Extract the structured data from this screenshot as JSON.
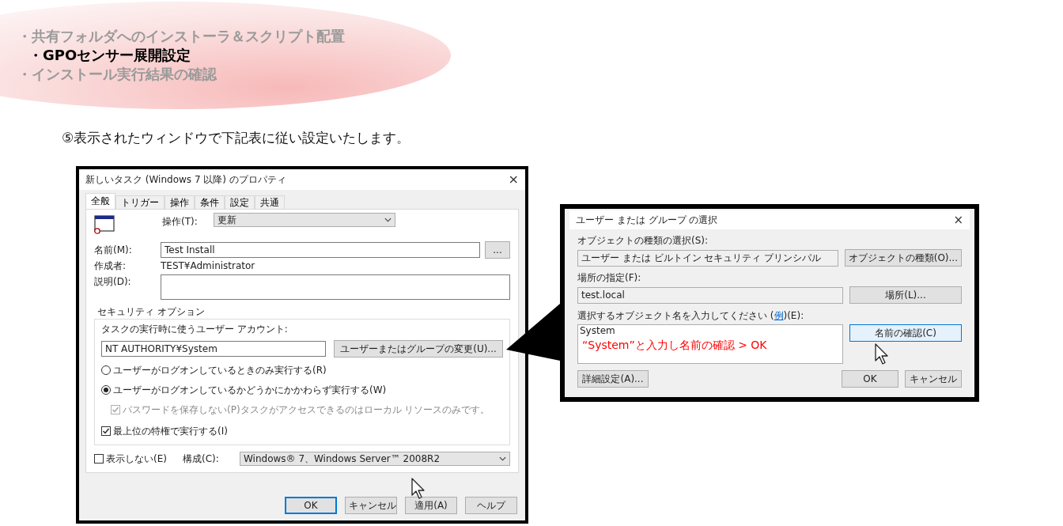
{
  "agenda": [
    {
      "text": "・共有フォルダへのインストーラ＆スクリプト配置",
      "selected": false
    },
    {
      "text": "・GPOセンサー展開設定",
      "selected": true
    },
    {
      "text": "・インストール実行結果の確認",
      "selected": false
    }
  ],
  "instruction": "⑤表示されたウィンドウで下記表に従い設定いたします。",
  "task_dialog": {
    "title": "新しいタスク (Windows 7 以降) のプロパティ",
    "close": "×",
    "tabs": [
      {
        "label": "全般",
        "selected": true
      },
      {
        "label": "トリガー",
        "selected": false
      },
      {
        "label": "操作",
        "selected": false
      },
      {
        "label": "条件",
        "selected": false
      },
      {
        "label": "設定",
        "selected": false
      },
      {
        "label": "共通",
        "selected": false
      }
    ],
    "action_label": "操作(T):",
    "action_value": "更新",
    "name_label": "名前(M):",
    "name_value": "Test Install",
    "browse_button": "...",
    "author_label": "作成者:",
    "author_value": "TEST¥Administrator",
    "description_label": "説明(D):",
    "security_group": "セキュリティ オプション",
    "account_label": "タスクの実行時に使うユーザー アカウント:",
    "account_value": "NT AUTHORITY¥System",
    "change_user_button": "ユーザーまたはグループの変更(U)...",
    "run_options": [
      {
        "label": "ユーザーがログオンしているときのみ実行する(R)",
        "selected": false
      },
      {
        "label": "ユーザーがログオンしているかどうかにかかわらず実行する(W)",
        "selected": true
      }
    ],
    "no_password": {
      "label": "パスワードを保存しない(P)タスクがアクセスできるのはローカル リソースのみです。",
      "checked": true,
      "disabled": true
    },
    "highest_privileges": {
      "label": "最上位の特権で実行する(I)",
      "checked": true,
      "disabled": false
    },
    "hidden": {
      "label": "表示しない(E)",
      "checked": false,
      "disabled": false
    },
    "configure_label": "構成(C):",
    "configure_value": "Windows® 7、Windows Server™ 2008R2",
    "buttons": [
      {
        "label": "OK",
        "default": true
      },
      {
        "label": "キャンセル",
        "default": false
      },
      {
        "label": "適用(A)",
        "default": false
      },
      {
        "label": "ヘルプ",
        "default": false
      }
    ]
  },
  "select_dialog": {
    "title": "ユーザー または グループ の選択",
    "close": "×",
    "object_type_label": "オブジェクトの種類の選択(S):",
    "object_type_value": "ユーザー または ビルトイン セキュリティ プリンシパル",
    "object_type_button": "オブジェクトの種類(O)...",
    "location_label": "場所の指定(F):",
    "location_value": "test.local",
    "location_button": "場所(L)...",
    "names_label_before": "選択するオブジェクト名を入力してください (",
    "names_label_link": "例",
    "names_label_after": ")(E):",
    "names_value": "System",
    "check_names_button": {
      "label": "名前の確認(C)",
      "focused": true
    },
    "annotation": "“System”と入力し名前の確認 > OK",
    "advanced_button": "詳細設定(A)...",
    "buttons": [
      {
        "label": "OK",
        "default": false
      },
      {
        "label": "キャンセル",
        "default": false
      }
    ]
  }
}
